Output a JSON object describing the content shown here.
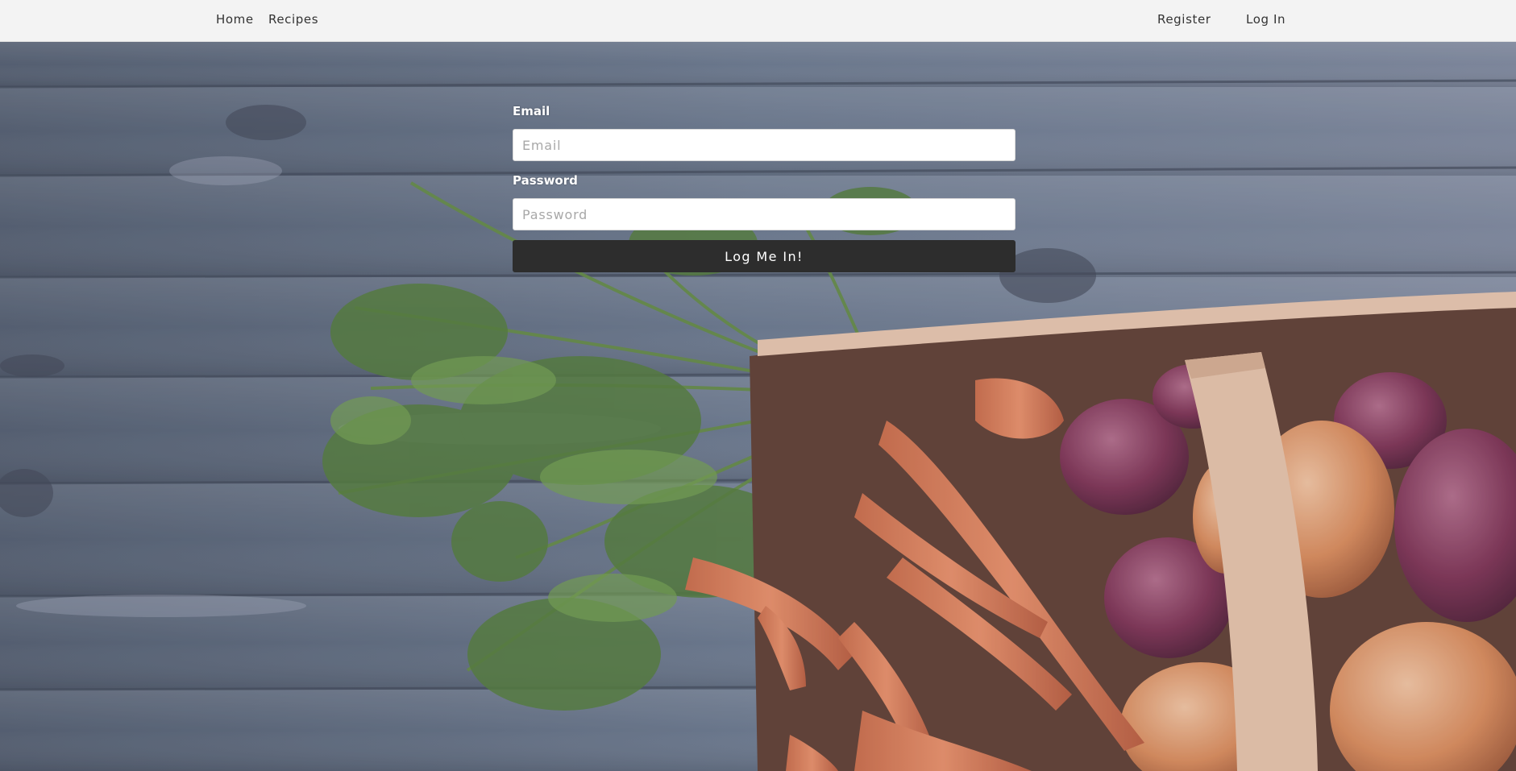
{
  "nav": {
    "home": "Home",
    "recipes": "Recipes",
    "register": "Register",
    "login": "Log In"
  },
  "form": {
    "email_label": "Email",
    "email_placeholder": "Email",
    "email_value": "",
    "password_label": "Password",
    "password_placeholder": "Password",
    "password_value": "",
    "submit_label": "Log Me In!"
  },
  "colors": {
    "navbar_bg": "#f3f3f3",
    "button_bg": "#2d2d2d",
    "label_text": "#ffffff"
  },
  "icons": {
    "background": "vegetable-basket-photo"
  }
}
